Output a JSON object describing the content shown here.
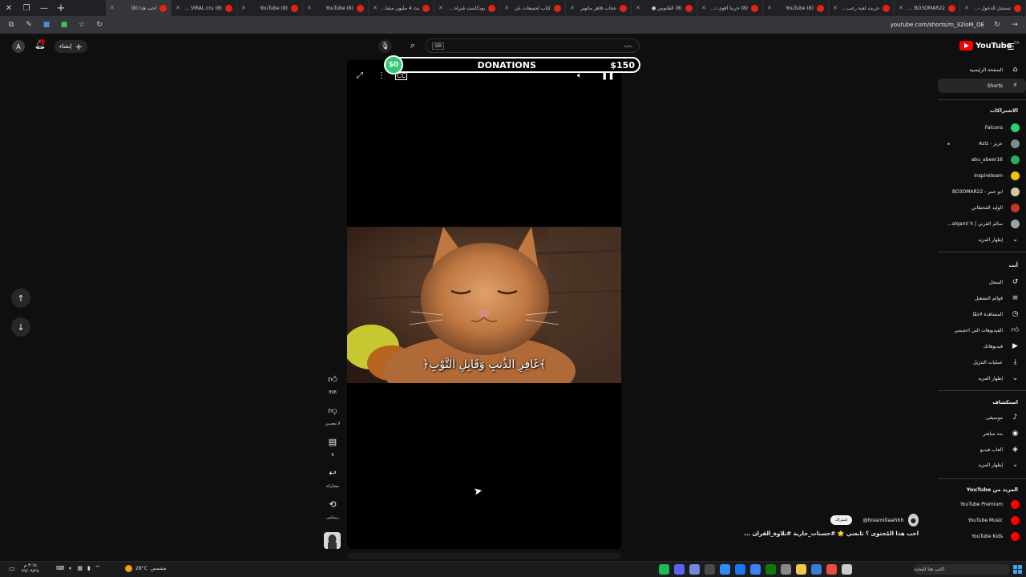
{
  "browser": {
    "tabs": [
      {
        "title": "تسجيل الدخول - ..."
      },
      {
        "title": "BO3OMAR22 - ..."
      },
      {
        "title": "جربت لعبة رعب - ..."
      },
      {
        "title": "YouTube (8)"
      },
      {
        "title": "(8) جربنا أقوى تام..."
      },
      {
        "title": "(8) القانوس ●"
      },
      {
        "title": "حجاب قاهر ماتوير"
      },
      {
        "title": "كتاب لجميعات بان"
      },
      {
        "title": "بودكاست مُبراه ..."
      },
      {
        "title": "بث 4 مليون مشاه..."
      },
      {
        "title": "YouTube (8)"
      },
      {
        "title": "YouTube (8)"
      },
      {
        "title": "the VIRAL cru (8)"
      },
      {
        "title": "أحب هذا (8)"
      }
    ],
    "url": "youtube.com/shorts/m_32loM_OE"
  },
  "header": {
    "avatar_letter": "A",
    "create_label": "إنشاء",
    "search_placeholder": "بحث",
    "logo_text": "YouTube",
    "logo_country": "SA"
  },
  "donations": {
    "current": "$0",
    "title": "DONATIONS",
    "goal": "$150"
  },
  "video": {
    "caption": "﴿غَافِرِ الذَّنبِ وَقَابِلِ التَّوْبِ﴾"
  },
  "actions": {
    "like_count": "898",
    "dislike_label": "لا يعجبني",
    "comment_count": "6",
    "share_label": "مشاركة",
    "remix_label": "ريمكس"
  },
  "channel": {
    "handle": "@bissmillaahhh",
    "subscribe_label": "اشتراك",
    "title": "أُحب هذا المُحتوى ؟ تابعني 🌟 #حسنات_جارية #تلاوة_القران ..."
  },
  "sidebar": {
    "main": [
      {
        "label": "الصفحة الرئيسية",
        "icon": "home-icon"
      },
      {
        "label": "Shorts",
        "icon": "shorts-icon"
      }
    ],
    "subs_heading": "الاشتراكات",
    "subscriptions": [
      {
        "label": "Falcons",
        "color": "#2ecc71"
      },
      {
        "label": "عزيز - Aziz",
        "color": "#7f8c8d"
      },
      {
        "label": "abu_abeer16",
        "color": "#27ae60"
      },
      {
        "label": "Inspireteam",
        "color": "#f1c40f"
      },
      {
        "label": "ابو عمر - BO3OMAR22",
        "color": "#d5c7a1"
      },
      {
        "label": "الوليد الفحطاني",
        "color": "#c0392b"
      },
      {
        "label": "سالم القرني | alqarni h...",
        "color": "#95a5a6"
      }
    ],
    "subs_more": "إظهار المزيد",
    "you_heading": "أنت",
    "you": [
      {
        "label": "السجل",
        "icon": "history-icon"
      },
      {
        "label": "قوائم التشغيل",
        "icon": "playlist-icon"
      },
      {
        "label": "المشاهدة لاحقًا",
        "icon": "clock-icon"
      },
      {
        "label": "الفيديوهات التي أعجبتني",
        "icon": "like-icon"
      },
      {
        "label": "فيديوهاتك",
        "icon": "video-icon"
      },
      {
        "label": "عمليات التنزيل",
        "icon": "download-icon"
      }
    ],
    "you_more": "إظهار المزيد",
    "explore_heading": "استكشاف",
    "explore": [
      {
        "label": "موسيقى",
        "icon": "music-icon"
      },
      {
        "label": "بث مباشر",
        "icon": "live-icon"
      },
      {
        "label": "ألعاب فيديو",
        "icon": "gaming-icon"
      }
    ],
    "explore_more": "إظهار المزيد",
    "more_heading": "المزيد من YouTube",
    "more": [
      {
        "label": "YouTube Premium",
        "color": "#ff0000"
      },
      {
        "label": "YouTube Music",
        "color": "#ff0000"
      },
      {
        "label": "YouTube Kids",
        "color": "#ff0000"
      }
    ]
  },
  "taskbar": {
    "time": "٣:١٥ م",
    "date": "٢٧/٠٩/٢٥",
    "weather": "28°C",
    "weather_label": "مشمس",
    "search_placeholder": "اكتب هنا للبحث",
    "app_colors": [
      "#1db954",
      "#5865f2",
      "#7289da",
      "#4a4a4a",
      "#2d8cff",
      "#1877f2",
      "#3b82f6",
      "#0e7a0d",
      "#888888",
      "#f2c94c",
      "#3a7bd5",
      "#e74c3c",
      "#cccccc"
    ]
  }
}
